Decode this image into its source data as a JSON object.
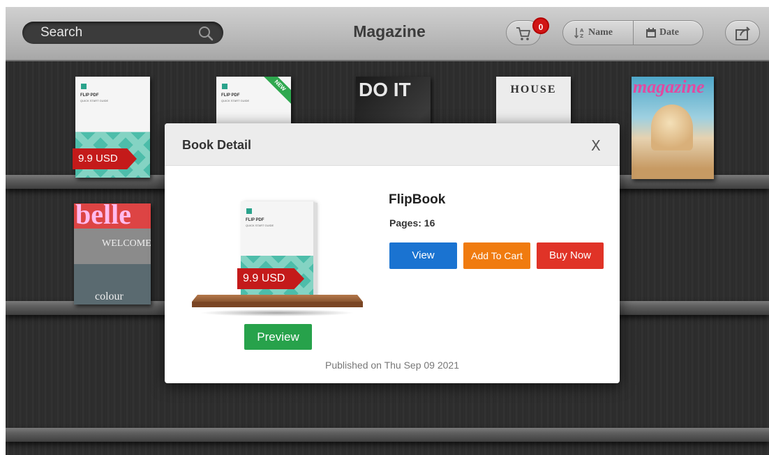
{
  "toolbar": {
    "search_placeholder": "Search",
    "title": "Magazine",
    "cart_count": "0",
    "sort_name_label": "Name",
    "sort_date_label": "Date"
  },
  "shelf": {
    "books": [
      {
        "title": "FLIP PDF",
        "subtitle": "QUICK START GUIDE",
        "price": "9.9 USD"
      },
      {
        "title": "FLIP PDF",
        "subtitle": "QUICK START GUIDE",
        "ribbon": "NEW"
      },
      {
        "cover_text": "DO IT"
      },
      {
        "cover_text": "HOUSE"
      },
      {
        "cover_text": "magazine"
      },
      {
        "cover_text": "belle",
        "sub": "WELCOME",
        "foot": "colour"
      }
    ]
  },
  "modal": {
    "title": "Book Detail",
    "close_label": "X",
    "book": {
      "cover_title": "FLIP PDF",
      "cover_subtitle": "QUICK START GUIDE",
      "price": "9.9 USD",
      "name": "FlipBook",
      "pages": "Pages: 16",
      "published": "Published on Thu Sep 09 2021"
    },
    "buttons": {
      "preview": "Preview",
      "view": "View",
      "add_to_cart": "Add To Cart",
      "buy_now": "Buy Now"
    }
  },
  "colors": {
    "view": "#1a73d1",
    "add_to_cart": "#f07b0f",
    "buy_now": "#e03327",
    "preview": "#27a24b",
    "price_tag": "#c41a1a",
    "cart_badge": "#d11515"
  }
}
